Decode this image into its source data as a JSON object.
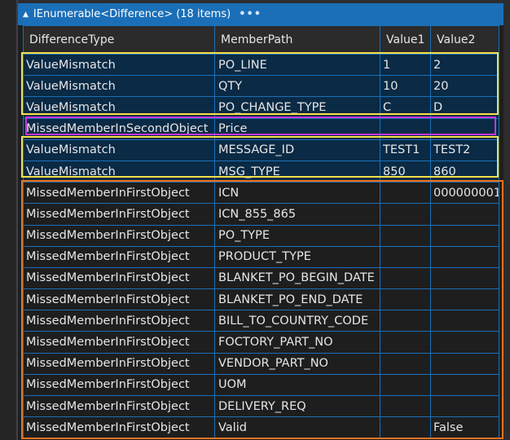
{
  "header": {
    "title": "IEnumerable<Difference> (18 items)",
    "expand_glyph": "▲",
    "more_glyph": "•••"
  },
  "columns": [
    "DifferenceType",
    "MemberPath",
    "Value1",
    "Value2"
  ],
  "rows": [
    {
      "type": "ValueMismatch",
      "path": "PO_LINE",
      "v1": "1",
      "v2": "2"
    },
    {
      "type": "ValueMismatch",
      "path": "QTY",
      "v1": "10",
      "v2": "20"
    },
    {
      "type": "ValueMismatch",
      "path": "PO_CHANGE_TYPE",
      "v1": "C",
      "v2": "D"
    },
    {
      "type": "MissedMemberInSecondObject",
      "path": "Price",
      "v1": "",
      "v2": ""
    },
    {
      "type": "ValueMismatch",
      "path": "MESSAGE_ID",
      "v1": "TEST1",
      "v2": "TEST2"
    },
    {
      "type": "ValueMismatch",
      "path": "MSG_TYPE",
      "v1": "850",
      "v2": "860"
    },
    {
      "type": "MissedMemberInFirstObject",
      "path": "ICN",
      "v1": "",
      "v2": "000000001"
    },
    {
      "type": "MissedMemberInFirstObject",
      "path": "ICN_855_865",
      "v1": "",
      "v2": ""
    },
    {
      "type": "MissedMemberInFirstObject",
      "path": "PO_TYPE",
      "v1": "",
      "v2": ""
    },
    {
      "type": "MissedMemberInFirstObject",
      "path": "PRODUCT_TYPE",
      "v1": "",
      "v2": ""
    },
    {
      "type": "MissedMemberInFirstObject",
      "path": "BLANKET_PO_BEGIN_DATE",
      "v1": "",
      "v2": ""
    },
    {
      "type": "MissedMemberInFirstObject",
      "path": "BLANKET_PO_END_DATE",
      "v1": "",
      "v2": ""
    },
    {
      "type": "MissedMemberInFirstObject",
      "path": "BILL_TO_COUNTRY_CODE",
      "v1": "",
      "v2": ""
    },
    {
      "type": "MissedMemberInFirstObject",
      "path": "FOCTORY_PART_NO",
      "v1": "",
      "v2": ""
    },
    {
      "type": "MissedMemberInFirstObject",
      "path": "VENDOR_PART_NO",
      "v1": "",
      "v2": ""
    },
    {
      "type": "MissedMemberInFirstObject",
      "path": "UOM",
      "v1": "",
      "v2": ""
    },
    {
      "type": "MissedMemberInFirstObject",
      "path": "DELIVERY_REQ",
      "v1": "",
      "v2": ""
    },
    {
      "type": "MissedMemberInFirstObject",
      "path": "Valid",
      "v1": "",
      "v2": "False"
    }
  ],
  "colors": {
    "header_bar": "#1b6fb8",
    "highlight_value_mismatch": "#f5e04a",
    "highlight_missed_second": "#c338d6",
    "highlight_missed_first": "#e8731e"
  }
}
